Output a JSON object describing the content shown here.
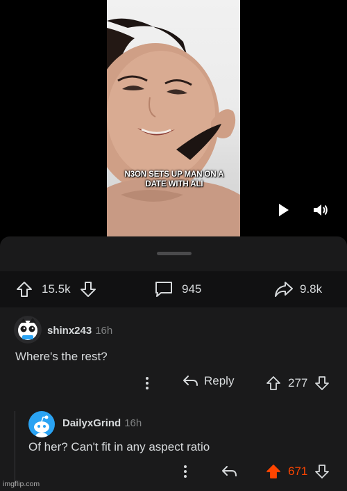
{
  "video": {
    "caption_line1": "N3ON SETS UP MAN ON A",
    "caption_line2": "DATE WITH ALI",
    "controls": {
      "play_icon": "play-icon",
      "volume_icon": "volume-icon"
    }
  },
  "post_actions": {
    "upvotes": "15.5k",
    "comments": "945",
    "shares": "9.8k"
  },
  "comments": [
    {
      "username": "shinx243",
      "time": "16h",
      "body": "Where's the rest?",
      "reply_label": "Reply",
      "votes": "277",
      "upvoted": false
    },
    {
      "username": "DailyxGrind",
      "time": "16h",
      "body": "Of her? Can't fit in any aspect ratio",
      "votes": "671",
      "upvoted": true
    }
  ],
  "watermark": "imgflip.com",
  "colors": {
    "background": "#000000",
    "sheet": "#1a1a1b",
    "action_bar": "#111112",
    "text": "#d7dadc",
    "muted": "#818384",
    "upvote_active": "#ff4500",
    "avatar_blue": "#2aa3f3"
  }
}
